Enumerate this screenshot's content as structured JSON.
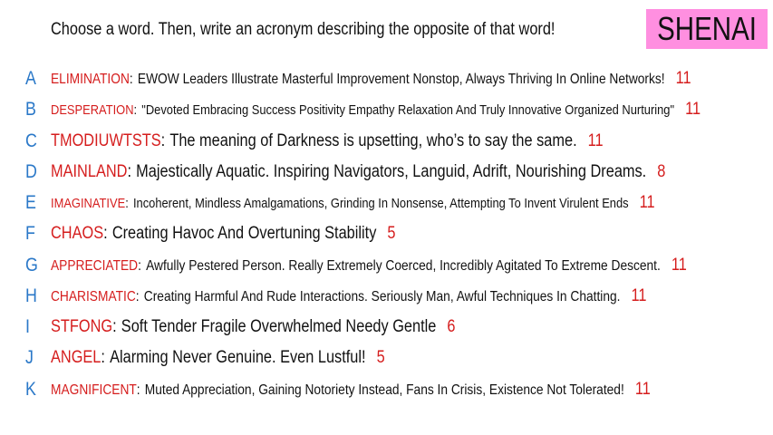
{
  "prompt": "Choose a word. Then, write an acronym describing the opposite of that word!",
  "badge": {
    "label": "SHENAI",
    "color": "#ff8fe0"
  },
  "colors": {
    "word": "#d51d1d",
    "letter": "#2a78c8",
    "text": "#111111"
  },
  "entries": [
    {
      "letter": "A",
      "word": "ELIMINATION",
      "acronym": "EWOW Leaders Illustrate Masterful Improvement Nonstop, Always Thriving In Online Networks!",
      "count": "11"
    },
    {
      "letter": "B",
      "word": "DESPERATION",
      "acronym": "\"Devoted Embracing Success Positivity Empathy Relaxation And Truly Innovative Organized Nurturing\"",
      "count": "11"
    },
    {
      "letter": "C",
      "word": "TMODIUWTSTS",
      "acronym": "The meaning of Darkness is upsetting, who’s to say the same.",
      "count": "11"
    },
    {
      "letter": "D",
      "word": "MAINLAND",
      "acronym": "Majestically Aquatic. Inspiring Navigators, Languid, Adrift, Nourishing Dreams.",
      "count": "8"
    },
    {
      "letter": "E",
      "word": "IMAGINATIVE",
      "acronym": "Incoherent, Mindless Amalgamations, Grinding In Nonsense, Attempting To Invent Virulent Ends",
      "count": "11"
    },
    {
      "letter": "F",
      "word": "CHAOS",
      "acronym": "Creating Havoc And Overtuning Stability",
      "count": "5"
    },
    {
      "letter": "G",
      "word": "APPRECIATED",
      "acronym": "Awfully Pestered Person. Really Extremely Coerced, Incredibly Agitated To Extreme Descent.",
      "count": "11"
    },
    {
      "letter": "H",
      "word": "CHARISMATIC",
      "acronym": "Creating Harmful And Rude Interactions. Seriously Man, Awful Techniques In Chatting.",
      "count": "11"
    },
    {
      "letter": "I",
      "word": "STFONG",
      "acronym": "Soft Tender Fragile Overwhelmed Needy Gentle",
      "count": "6"
    },
    {
      "letter": "J",
      "word": "ANGEL",
      "acronym": "Alarming Never Genuine. Even Lustful!",
      "count": "5"
    },
    {
      "letter": "K",
      "word": "MAGNIFICENT",
      "acronym": "Muted Appreciation, Gaining Notoriety Instead, Fans In Crisis, Existence Not Tolerated!",
      "count": "11"
    }
  ]
}
